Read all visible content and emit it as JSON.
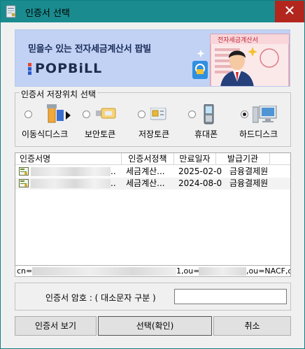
{
  "window": {
    "title": "인증서 선택",
    "close_glyph": "✕"
  },
  "banner": {
    "headline": "믿을수 있는 전자세금계산서 팝빌",
    "brand": "POPBiLL",
    "doc_title": "전자세금계산서"
  },
  "storage": {
    "legend": "인증서 저장위치 선택",
    "options": [
      {
        "label": "이동식디스크",
        "icon": "usb-drive-icon",
        "checked": false
      },
      {
        "label": "보안토큰",
        "icon": "security-token-icon",
        "checked": false
      },
      {
        "label": "저장토큰",
        "icon": "smart-card-icon",
        "checked": false
      },
      {
        "label": "휴대폰",
        "icon": "mobile-phone-icon",
        "checked": false
      },
      {
        "label": "하드디스크",
        "icon": "computer-icon",
        "checked": true
      }
    ]
  },
  "cert_list": {
    "columns": [
      "인증서명",
      "인증서정책",
      "만료일자",
      "발급기관"
    ],
    "rows": [
      {
        "name": "",
        "policy": "세금계산...",
        "expiry": "2025-02-06",
        "issuer": "금융결제원"
      },
      {
        "name": "",
        "policy": "세금계산...",
        "expiry": "2024-08-04",
        "issuer": "금융결제원"
      }
    ]
  },
  "dn": {
    "prefix": "cn=",
    "middle": "1,ou=",
    "suffix": ",ou=NACF,ou="
  },
  "password": {
    "label": "인증서 암호 : ( 대소문자 구분 )",
    "value": ""
  },
  "buttons": {
    "view": "인증서 보기",
    "confirm": "선택(확인)",
    "cancel": "취소"
  },
  "colors": {
    "titlebar": "#1a8b8e",
    "close": "#b3261e",
    "banner_bg": "#c2d2f5"
  }
}
